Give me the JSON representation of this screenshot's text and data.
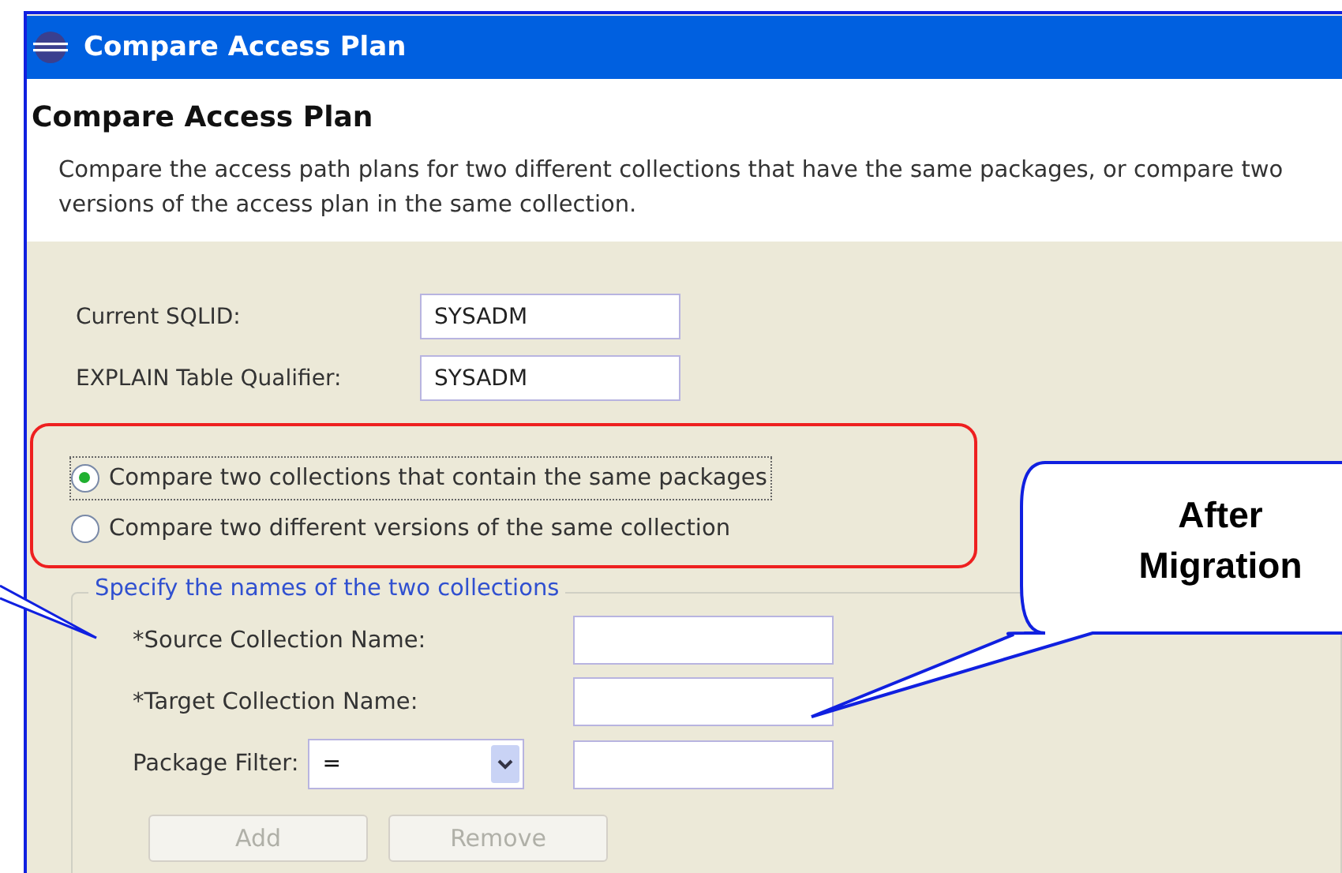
{
  "window": {
    "title": "Compare Access Plan"
  },
  "header": {
    "title": "Compare Access Plan",
    "description": "Compare the access path plans for two different collections that have the same packages, or compare two versions of the access plan in the same collection."
  },
  "fields": [
    {
      "label": "Current SQLID:",
      "value": "SYSADM"
    },
    {
      "label": "EXPLAIN Table Qualifier:",
      "value": "SYSADM"
    }
  ],
  "options": [
    {
      "label": "Compare two collections that contain the same packages",
      "selected": true
    },
    {
      "label": "Compare two different versions of the same collection",
      "selected": false
    }
  ],
  "group": {
    "legend": "Specify the names of the two collections",
    "fields": [
      {
        "label": "*Source Collection Name:"
      },
      {
        "label": "*Target Collection Name:"
      }
    ],
    "filter": {
      "label": "Package Filter:",
      "operator": "="
    }
  },
  "buttons": [
    {
      "label": "Add",
      "disabled": true
    },
    {
      "label": "Remove",
      "disabled": true
    }
  ],
  "callout": {
    "lines": [
      "After",
      "Migration"
    ]
  }
}
